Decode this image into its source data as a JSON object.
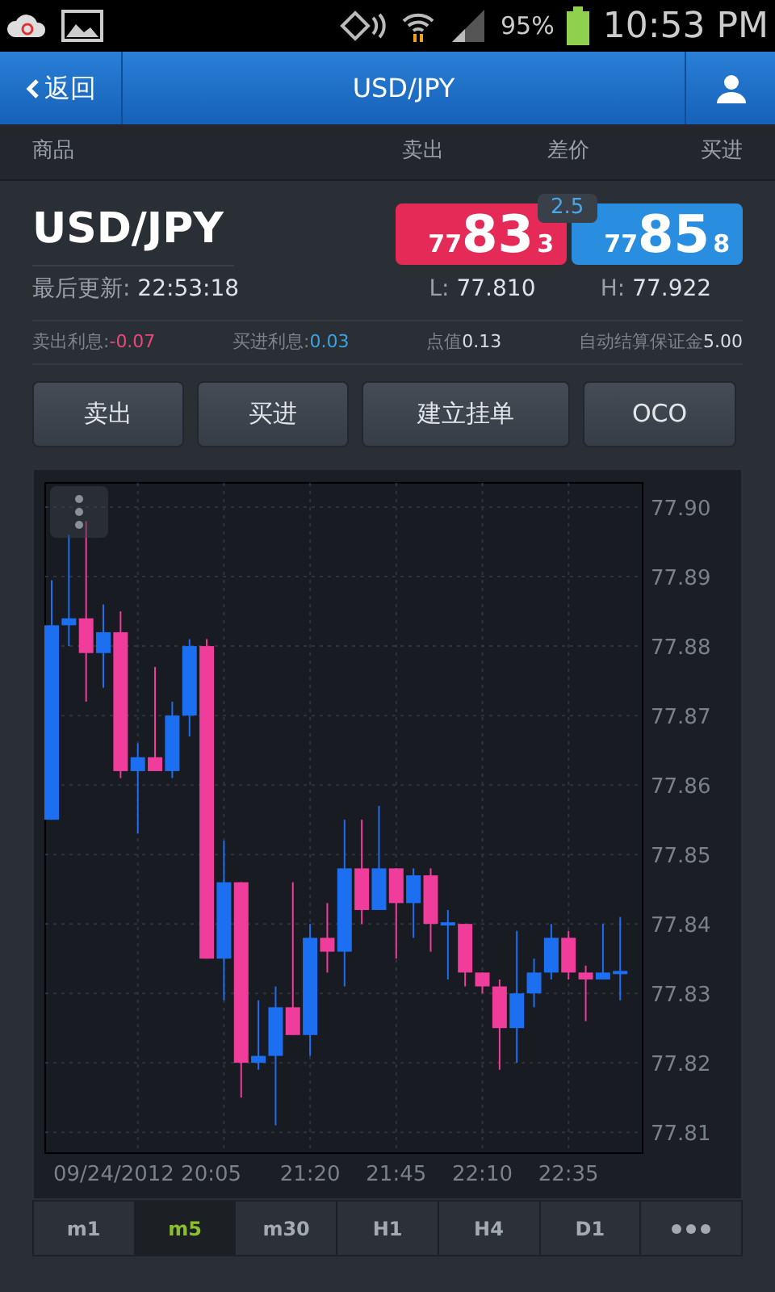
{
  "status_bar": {
    "battery": "95%",
    "time": "10:53 PM"
  },
  "header": {
    "back": "返回",
    "title": "USD/JPY"
  },
  "columns": [
    "商品",
    "卖出",
    "差价",
    "买进"
  ],
  "quote": {
    "symbol": "USD/JPY",
    "updated_label": "最后更新:",
    "updated_time": "22:53:18",
    "sell": {
      "prefix": "77",
      "big": "83",
      "suffix": "3"
    },
    "spread": "2.5",
    "buy": {
      "prefix": "77",
      "big": "85",
      "suffix": "8"
    },
    "low_label": "L:",
    "low": "77.810",
    "high_label": "H:",
    "high": "77.922"
  },
  "stats": [
    {
      "label": "卖出利息:",
      "value": "-0.07",
      "color": "#e9487a"
    },
    {
      "label": "买进利息:",
      "value": "0.03",
      "color": "#3aa3e0"
    },
    {
      "label": "点值",
      "value": "0.13",
      "color": "#d8dde3"
    },
    {
      "label": "自动结算保证金",
      "value": "5.00",
      "color": "#d8dde3"
    }
  ],
  "actions": [
    "卖出",
    "买进",
    "建立挂单",
    "OCO"
  ],
  "chart": {
    "date_label": "09/24/2012 20:05",
    "chart_data": {
      "type": "candlestick",
      "grid": true,
      "categories": [
        null,
        null,
        null,
        null,
        null,
        null,
        null,
        null,
        null,
        null,
        null,
        null,
        null,
        null,
        null,
        "21:20",
        null,
        null,
        null,
        null,
        "21:45",
        null,
        null,
        null,
        null,
        "22:10",
        null,
        null,
        null,
        null,
        "22:35",
        null,
        null,
        null
      ],
      "ohlc": [
        [
          77.855,
          77.8895,
          77.855,
          77.883
        ],
        [
          77.883,
          77.896,
          77.88,
          77.884
        ],
        [
          77.884,
          77.898,
          77.872,
          77.879
        ],
        [
          77.879,
          77.886,
          77.874,
          77.882
        ],
        [
          77.882,
          77.885,
          77.861,
          77.862
        ],
        [
          77.862,
          77.866,
          77.853,
          77.864
        ],
        [
          77.864,
          77.877,
          77.862,
          77.862
        ],
        [
          77.862,
          77.872,
          77.861,
          77.87
        ],
        [
          77.87,
          77.881,
          77.867,
          77.88
        ],
        [
          77.88,
          77.881,
          77.835,
          77.835
        ],
        [
          77.835,
          77.852,
          77.829,
          77.846
        ],
        [
          77.846,
          77.846,
          77.815,
          77.82
        ],
        [
          77.82,
          77.829,
          77.819,
          77.821
        ],
        [
          77.821,
          77.831,
          77.811,
          77.828
        ],
        [
          77.828,
          77.846,
          77.824,
          77.824
        ],
        [
          77.824,
          77.84,
          77.821,
          77.838
        ],
        [
          77.838,
          77.843,
          77.833,
          77.836
        ],
        [
          77.836,
          77.855,
          77.831,
          77.848
        ],
        [
          77.848,
          77.855,
          77.84,
          77.842
        ],
        [
          77.842,
          77.857,
          77.842,
          77.848
        ],
        [
          77.848,
          77.848,
          77.835,
          77.843
        ],
        [
          77.843,
          77.848,
          77.838,
          77.847
        ],
        [
          77.847,
          77.848,
          77.836,
          77.84
        ],
        [
          77.84,
          77.842,
          77.832,
          77.84
        ],
        [
          77.84,
          77.84,
          77.831,
          77.833
        ],
        [
          77.833,
          77.833,
          77.83,
          77.831
        ],
        [
          77.831,
          77.832,
          77.819,
          77.825
        ],
        [
          77.825,
          77.839,
          77.82,
          77.83
        ],
        [
          77.83,
          77.835,
          77.828,
          77.833
        ],
        [
          77.833,
          77.84,
          77.832,
          77.838
        ],
        [
          77.838,
          77.839,
          77.832,
          77.833
        ],
        [
          77.833,
          77.834,
          77.826,
          77.832
        ],
        [
          77.832,
          77.84,
          77.832,
          77.833
        ],
        [
          77.833,
          77.841,
          77.829,
          77.833
        ]
      ],
      "ylim": [
        77.807,
        77.9035
      ],
      "yticks": [
        {
          "value": 77.9,
          "label": "77.90"
        },
        {
          "value": 77.89,
          "label": "77.89"
        },
        {
          "value": 77.88,
          "label": "77.88"
        },
        {
          "value": 77.87,
          "label": "77.87"
        },
        {
          "value": 77.86,
          "label": "77.86"
        },
        {
          "value": 77.85,
          "label": "77.85"
        },
        {
          "value": 77.84,
          "label": "77.84"
        },
        {
          "value": 77.83,
          "label": "77.83"
        },
        {
          "value": 77.82,
          "label": "77.82"
        },
        {
          "value": 77.81,
          "label": "77.81"
        }
      ]
    }
  },
  "timeframes": [
    {
      "label": "m1",
      "selected": false
    },
    {
      "label": "m5",
      "selected": true
    },
    {
      "label": "m30",
      "selected": false
    },
    {
      "label": "H1",
      "selected": false
    },
    {
      "label": "H4",
      "selected": false
    },
    {
      "label": "D1",
      "selected": false
    }
  ]
}
